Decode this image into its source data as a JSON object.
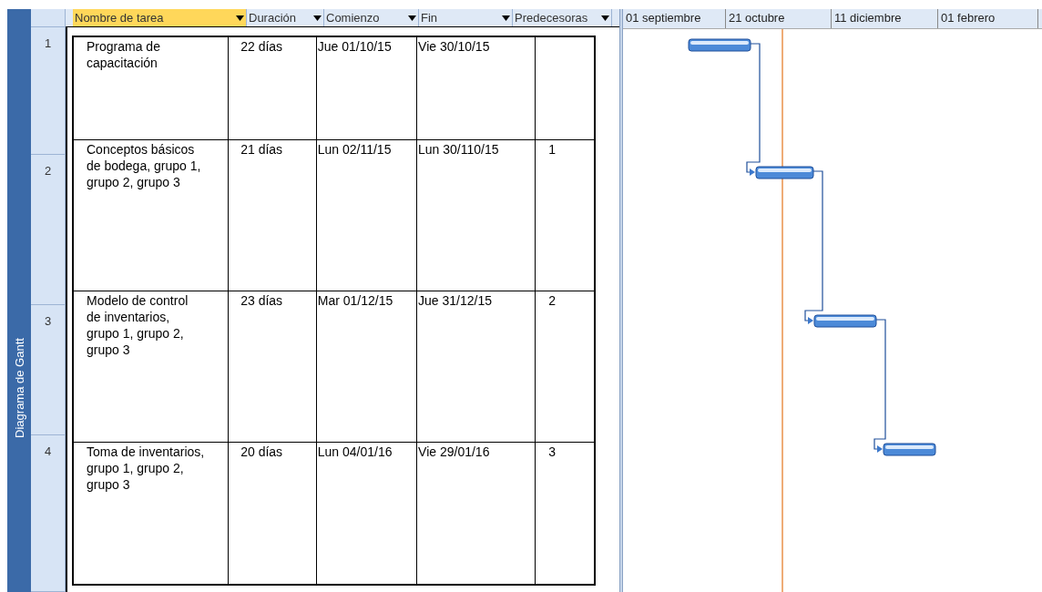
{
  "view_bar": {
    "label": "Diagrama de Gantt"
  },
  "columns": [
    {
      "label": "Nombre de tarea",
      "selected": true
    },
    {
      "label": "Duración",
      "selected": false
    },
    {
      "label": "Comienzo",
      "selected": false
    },
    {
      "label": "Fin",
      "selected": false
    },
    {
      "label": "Predecesoras",
      "selected": false
    }
  ],
  "rows": [
    {
      "number": "1",
      "name": "Programa de capacitación",
      "duration": "22 días",
      "start": "Jue 01/10/15",
      "finish": "Vie 30/10/15",
      "predecessors": ""
    },
    {
      "number": "2",
      "name": "Conceptos básicos de bodega, grupo 1, grupo 2, grupo 3",
      "duration": "21 días",
      "start": "Lun 02/11/15",
      "finish": "Lun 30/110/15",
      "predecessors": "1"
    },
    {
      "number": "3",
      "name": "Modelo de control de inventarios, grupo 1, grupo 2, grupo 3",
      "duration": "23 días",
      "start": "Mar 01/12/15",
      "finish": "Jue 31/12/15",
      "predecessors": "2"
    },
    {
      "number": "4",
      "name": "Toma de inventarios, grupo 1, grupo 2, grupo 3",
      "duration": "20 días",
      "start": "Lun 04/01/16",
      "finish": "Vie 29/01/16",
      "predecessors": "3"
    }
  ],
  "timescale": [
    "01 septiembre",
    "21 octubre",
    "11 diciembre",
    "01 febrero"
  ]
}
